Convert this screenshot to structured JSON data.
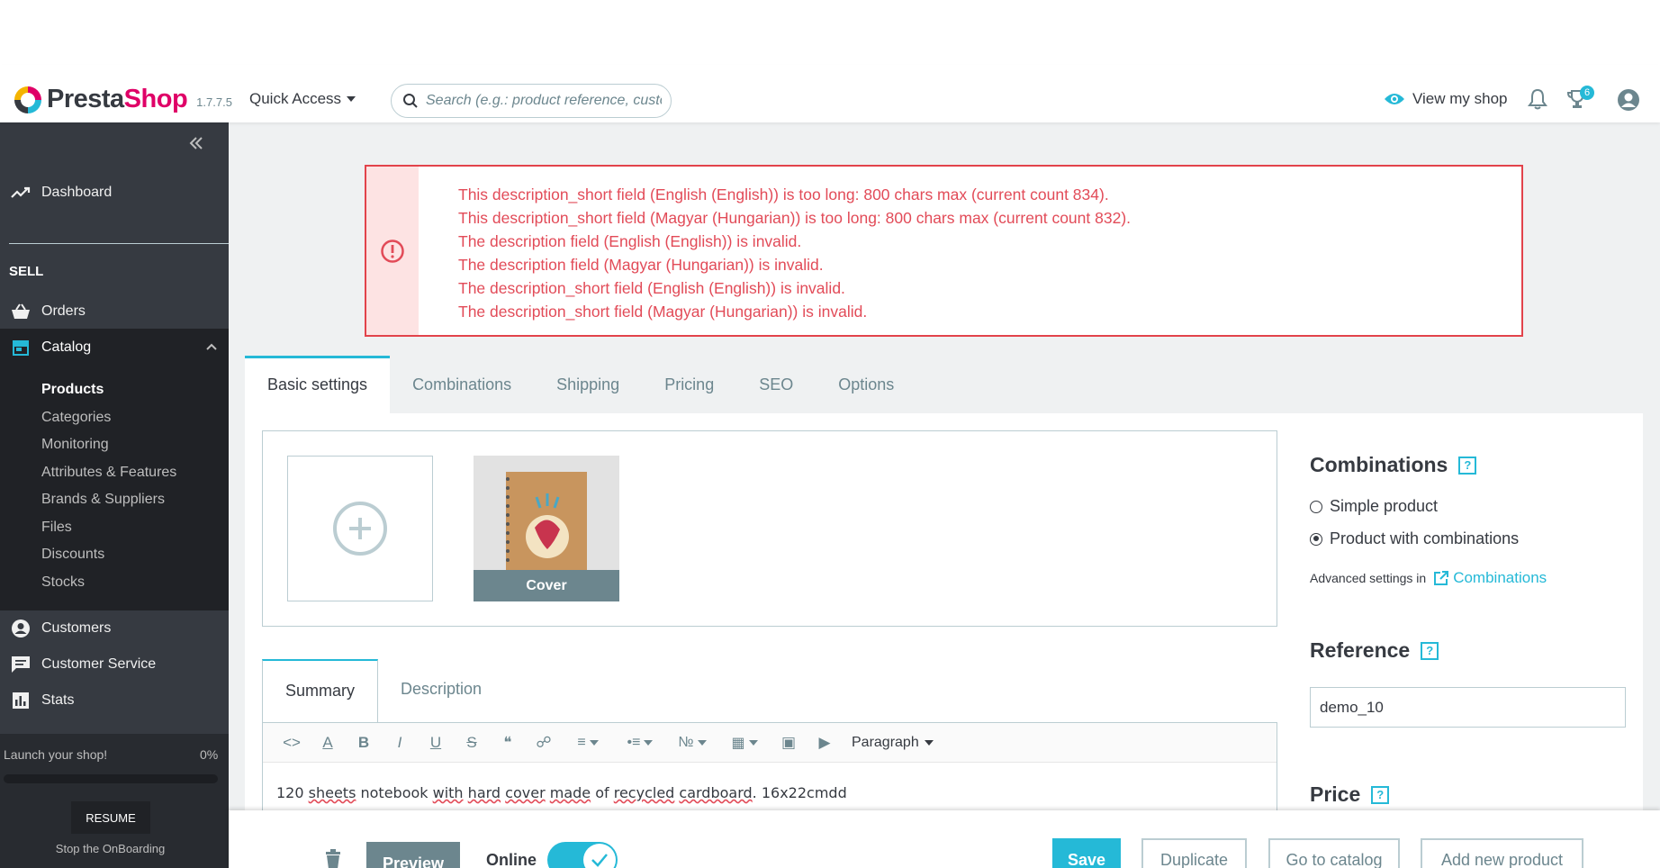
{
  "header": {
    "brand_left": "Presta",
    "brand_right": "Shop",
    "version": "1.7.7.5",
    "quick_access": "Quick Access",
    "search_placeholder": "Search (e.g.: product reference, custome",
    "view_shop": "View my shop",
    "notification_count": "6"
  },
  "sidebar": {
    "dashboard": "Dashboard",
    "sell_heading": "SELL",
    "orders": "Orders",
    "catalog": "Catalog",
    "catalog_items": [
      "Products",
      "Categories",
      "Monitoring",
      "Attributes & Features",
      "Brands & Suppliers",
      "Files",
      "Discounts",
      "Stocks"
    ],
    "customers": "Customers",
    "customer_service": "Customer Service",
    "stats": "Stats",
    "launch_text": "Launch your shop!",
    "launch_pct": "0%",
    "launch_progress": 0,
    "resume": "RESUME",
    "stop_onboarding": "Stop the OnBoarding"
  },
  "alert": {
    "messages": [
      "This description_short field (English (English)) is too long: 800 chars max (current count 834).",
      "This description_short field (Magyar (Hungarian)) is too long: 800 chars max (current count 832).",
      "The description field (English (English)) is invalid.",
      "The description field (Magyar (Hungarian)) is invalid.",
      "The description_short field (English (English)) is invalid.",
      "The description_short field (Magyar (Hungarian)) is invalid."
    ]
  },
  "tabs": [
    "Basic settings",
    "Combinations",
    "Shipping",
    "Pricing",
    "SEO",
    "Options"
  ],
  "images": {
    "cover_label": "Cover"
  },
  "editor": {
    "tabs": [
      "Summary",
      "Description"
    ],
    "format": "Paragraph",
    "content_parts": [
      "120 ",
      "sheets",
      " notebook ",
      "with",
      " ",
      "hard",
      " ",
      "cover",
      " ",
      "made",
      " of ",
      "recycled",
      " ",
      "cardboard",
      ". 16x22cmdd"
    ]
  },
  "right": {
    "combinations_title": "Combinations",
    "simple_product": "Simple product",
    "product_with_combinations": "Product with combinations",
    "advanced_settings": "Advanced settings in",
    "advanced_link": "Combinations",
    "reference_title": "Reference",
    "reference_value": "demo_10",
    "price_title": "Price",
    "help_glyph": "?"
  },
  "footer": {
    "preview": "Preview",
    "online": "Online",
    "save": "Save",
    "duplicate": "Duplicate",
    "go_to_catalog": "Go to catalog",
    "add_new_product": "Add new product"
  },
  "colors": {
    "accent": "#25b9d7",
    "brand": "#df0067",
    "sidebar": "#363a41",
    "error": "#e24b58"
  }
}
